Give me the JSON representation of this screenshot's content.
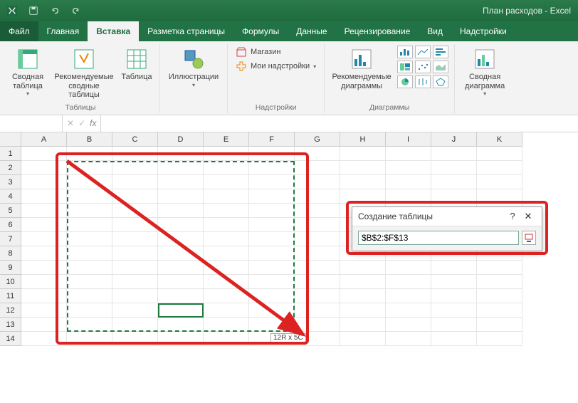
{
  "title": "План расходов - Excel",
  "tabs": {
    "file": "Файл",
    "home": "Главная",
    "insert": "Вставка",
    "pagelayout": "Разметка страницы",
    "formulas": "Формулы",
    "data": "Данные",
    "review": "Рецензирование",
    "view": "Вид",
    "addins": "Надстройки"
  },
  "ribbon": {
    "tables": {
      "pivot": "Сводная таблица",
      "recommended": "Рекомендуемые сводные таблицы",
      "table": "Таблица",
      "group": "Таблицы"
    },
    "illustrations": {
      "label": "Иллюстрации",
      "group": ""
    },
    "addins": {
      "store": "Магазин",
      "myaddins": "Мои надстройки",
      "group": "Надстройки"
    },
    "charts": {
      "recommended": "Рекомендуемые диаграммы",
      "group": "Диаграммы"
    },
    "pivotchart": {
      "label": "Сводная диаграмма"
    }
  },
  "formula_bar": {
    "name_box": "",
    "fx": "fx",
    "value": ""
  },
  "columns": [
    "A",
    "B",
    "C",
    "D",
    "E",
    "F",
    "G",
    "H",
    "I",
    "J",
    "K"
  ],
  "rows": [
    "1",
    "2",
    "3",
    "4",
    "5",
    "6",
    "7",
    "8",
    "9",
    "10",
    "11",
    "12",
    "13",
    "14"
  ],
  "selection_hint": "12R x 5C",
  "dialog": {
    "title": "Создание таблицы",
    "input": "$B$2:$F$13"
  }
}
